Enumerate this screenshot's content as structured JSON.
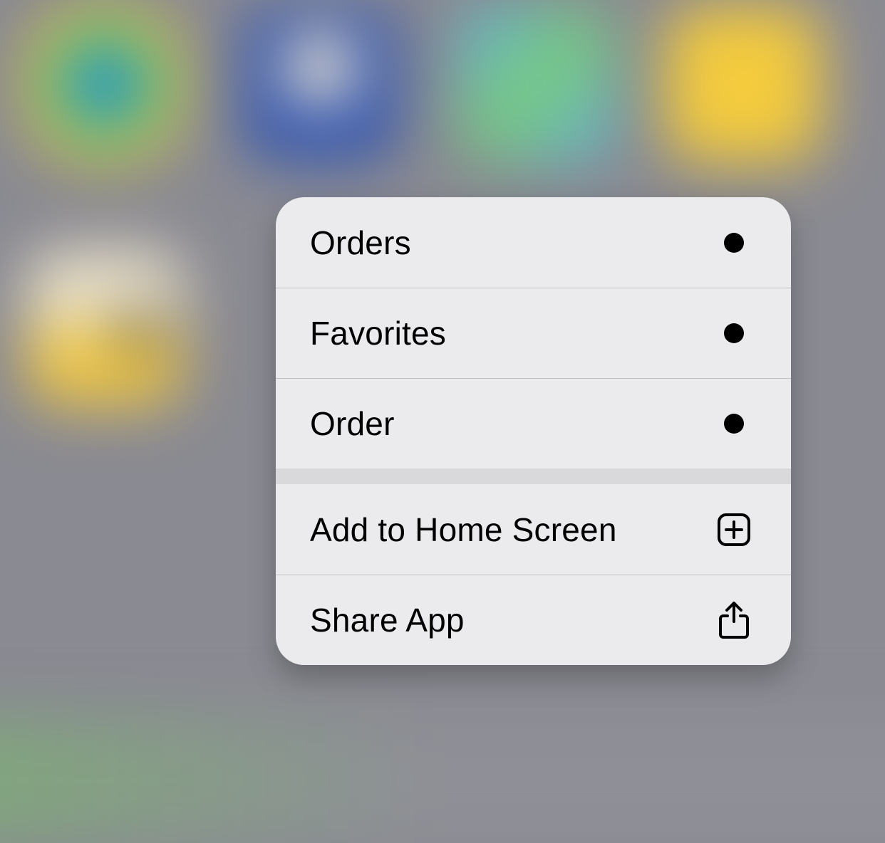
{
  "menu": {
    "group1": [
      {
        "label": "Orders",
        "icon": "dot"
      },
      {
        "label": "Favorites",
        "icon": "dot"
      },
      {
        "label": "Order",
        "icon": "dot"
      }
    ],
    "group2": [
      {
        "label": "Add to Home Screen",
        "icon": "plus-square"
      },
      {
        "label": "Share App",
        "icon": "share"
      }
    ]
  }
}
